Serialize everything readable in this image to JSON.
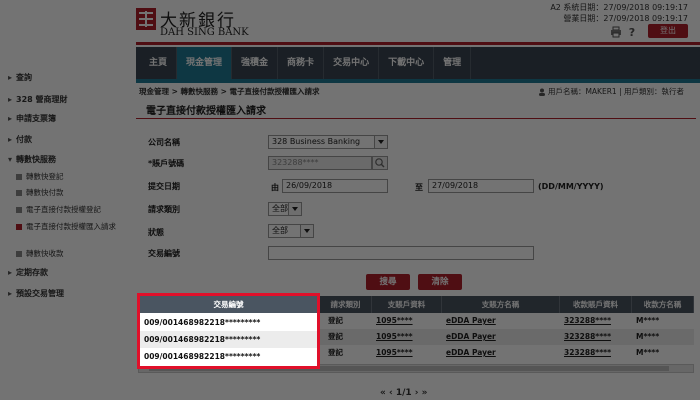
{
  "header": {
    "logo_cn": "大新銀行",
    "logo_en": "DAH SING BANK",
    "system_date": "A2 系統日期：27/09/2018 09:19:17",
    "work_date": "營業日期：27/09/2018 09:19:17",
    "logout_label": "登出",
    "print_icon": "printer-icon",
    "help_icon": "help-icon"
  },
  "nav": {
    "items": [
      "主頁",
      "現金管理",
      "強積金",
      "商務卡",
      "交易中心",
      "下載中心",
      "管理"
    ],
    "active_index": 1
  },
  "breadcrumb": "現金管理 > 轉數快服務 > 電子直接付款授權匯入請求",
  "user": {
    "label": "用戶名稱：MAKER1 | 用戶類別：執行者"
  },
  "page_title": "電子直接付款授權匯入請求",
  "sidebar": {
    "items": [
      {
        "label": "查詢"
      },
      {
        "label": "328 營商理財"
      },
      {
        "label": "申請支票簿"
      },
      {
        "label": "付款"
      },
      {
        "label": "轉數快服務"
      },
      {
        "label": "定期存款"
      },
      {
        "label": "預設交易管理"
      }
    ],
    "subitems": [
      {
        "label": "轉數快登記"
      },
      {
        "label": "轉數快付款"
      },
      {
        "label": "電子直接付款授權登記"
      },
      {
        "label": "電子直接付款授權匯入請求"
      },
      {
        "label": "轉數快收款"
      }
    ]
  },
  "form": {
    "company_label": "公司名稱",
    "company_value": "328 Business Banking",
    "account_label": "*賬戶號碼",
    "account_value": "323288****",
    "date_label": "提交日期",
    "from_label": "由",
    "from_value": "26/09/2018",
    "to_label": "至",
    "to_value": "27/09/2018",
    "date_format": "(DD/MM/YYYY)",
    "request_type_label": "請求類別",
    "request_type_value": "全部",
    "status_label": "狀態",
    "status_value": "全部",
    "txn_no_label": "交易編號",
    "txn_no_value": ""
  },
  "buttons": {
    "search": "搜尋",
    "clear": "清除"
  },
  "table": {
    "headers": [
      "交易編號",
      "請求類別",
      "支賬戶資料",
      "支賬方名稱",
      "收款賬戶資料",
      "收款方名稱"
    ],
    "rows": [
      [
        "009/001468982218*********",
        "登記",
        "1095****",
        "eDDA Payer",
        "323288****",
        "M****"
      ],
      [
        "009/001468982218*********",
        "登記",
        "1095****",
        "eDDA Payer",
        "323288****",
        "M****"
      ],
      [
        "009/001468982218*********",
        "登記",
        "1095****",
        "eDDA Payer",
        "323288****",
        "M****"
      ]
    ]
  },
  "pager": {
    "label": "1/1"
  },
  "colors": {
    "brand_red": "#b0202a",
    "nav_dark": "#3b4652",
    "nav_active": "#1f7a94",
    "highlight": "#e0102a"
  }
}
